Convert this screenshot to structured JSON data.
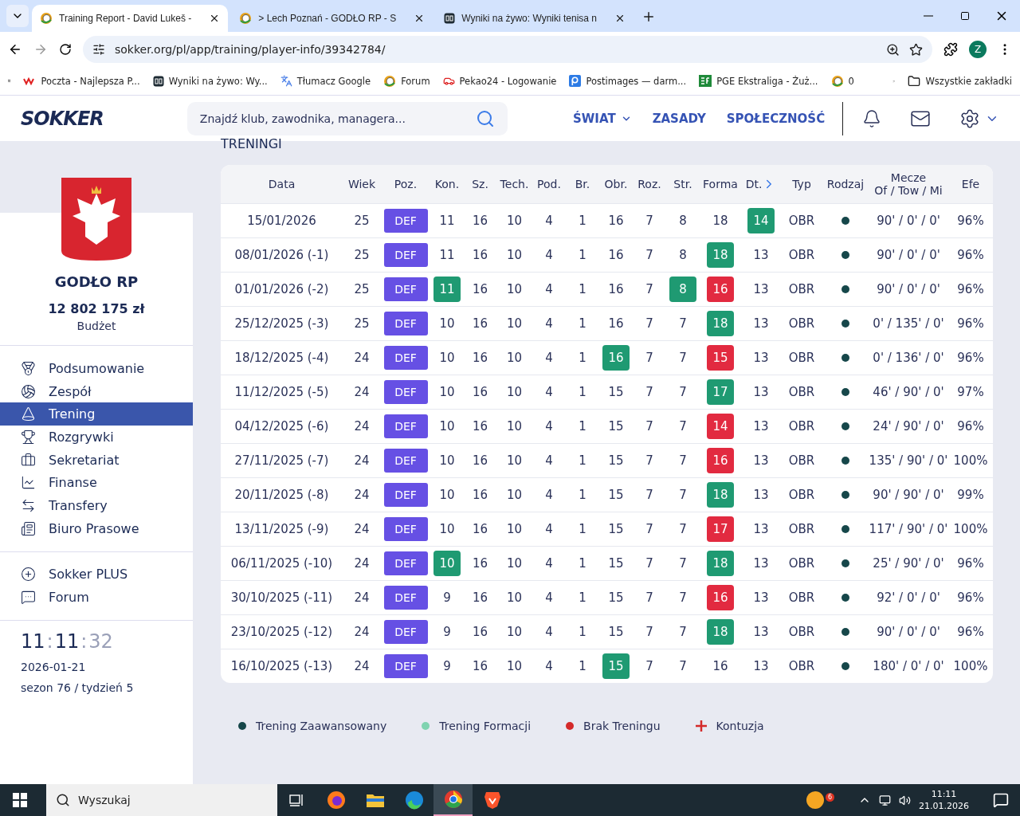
{
  "browser": {
    "tabs": [
      {
        "title": "Training Report - David Lukeš -",
        "selected": true
      },
      {
        "title": "> Lech Poznań - GODŁO RP - S",
        "selected": false
      },
      {
        "title": "Wyniki na żywo: Wyniki tenisa n",
        "selected": false
      }
    ],
    "url": "sokker.org/pl/app/training/player-info/39342784/",
    "profile": "Z",
    "bookmarks": [
      {
        "label": "Poczta - Najlepsza P..."
      },
      {
        "label": "Wyniki na żywo: Wy..."
      },
      {
        "label": "Tłumacz Google"
      },
      {
        "label": "Forum"
      },
      {
        "label": "Pekao24 - Logowanie"
      },
      {
        "label": "Postimages — darm..."
      },
      {
        "label": "PGE Ekstraliga - Żuż..."
      },
      {
        "label": "0"
      }
    ],
    "all_bookmarks": "Wszystkie zakładki"
  },
  "header": {
    "logo": "SOKKER",
    "search_placeholder": "Znajdź klub, zawodnika, managera...",
    "nav": [
      {
        "label": "ŚWIAT",
        "dropdown": true
      },
      {
        "label": "ZASADY",
        "dropdown": false
      },
      {
        "label": "SPOŁECZNOŚĆ",
        "dropdown": false
      }
    ]
  },
  "sidebar": {
    "club": "GODŁO RP",
    "budget": "12 802 175 zł",
    "budget_label": "Budżet",
    "menu": [
      {
        "label": "Podsumowanie",
        "selected": false
      },
      {
        "label": "Zespół",
        "selected": false
      },
      {
        "label": "Trening",
        "selected": true
      },
      {
        "label": "Rozgrywki",
        "selected": false
      },
      {
        "label": "Sekretariat",
        "selected": false
      },
      {
        "label": "Finanse",
        "selected": false
      },
      {
        "label": "Transfery",
        "selected": false
      },
      {
        "label": "Biuro Prasowe",
        "selected": false
      }
    ],
    "extra": [
      {
        "label": "Sokker PLUS",
        "selected": false
      },
      {
        "label": "Forum",
        "selected": false
      }
    ],
    "clock": [
      {
        "text": "11",
        "dim": false
      },
      {
        "text": ":",
        "dim": true
      },
      {
        "text": "11",
        "dim": false
      },
      {
        "text": ":",
        "dim": true
      },
      {
        "text": "32",
        "dim": true
      }
    ],
    "date": "2026-01-21",
    "season": "sezon 76 / tydzień 5"
  },
  "table": {
    "title": "TRENINGI",
    "columns": [
      {
        "label": "Data"
      },
      {
        "label": "Wiek"
      },
      {
        "label": "Poz."
      },
      {
        "label": "Kon."
      },
      {
        "label": "Sz."
      },
      {
        "label": "Tech."
      },
      {
        "label": "Pod."
      },
      {
        "label": "Br."
      },
      {
        "label": "Obr."
      },
      {
        "label": "Roz."
      },
      {
        "label": "Str."
      },
      {
        "label": "Forma"
      },
      {
        "label": "Dt.",
        "more": true
      },
      {
        "label": "Typ"
      },
      {
        "label": "Rodzaj"
      },
      {
        "label": "Mecze",
        "sub": "Of / Tow / Mi"
      },
      {
        "label": "Efe"
      }
    ],
    "rows": [
      {
        "date": "15/01/2026",
        "age": "25",
        "pos": "DEF",
        "stats": [
          {
            "v": "11",
            "up": false,
            "down": false
          },
          {
            "v": "16",
            "up": false,
            "down": false
          },
          {
            "v": "10",
            "up": false,
            "down": false
          },
          {
            "v": "4",
            "up": false,
            "down": false
          },
          {
            "v": "1",
            "up": false,
            "down": false
          },
          {
            "v": "16",
            "up": false,
            "down": false
          },
          {
            "v": "7",
            "up": false,
            "down": false
          },
          {
            "v": "8",
            "up": false,
            "down": false
          },
          {
            "v": "18",
            "up": false,
            "down": false
          },
          {
            "v": "14",
            "up": true,
            "down": false
          }
        ],
        "type": "OBR",
        "color": "#16474a",
        "matches": "90' / 0' / 0'",
        "eff": "96%"
      },
      {
        "date": "08/01/2026 (-1)",
        "age": "25",
        "pos": "DEF",
        "stats": [
          {
            "v": "11",
            "up": false,
            "down": false
          },
          {
            "v": "16",
            "up": false,
            "down": false
          },
          {
            "v": "10",
            "up": false,
            "down": false
          },
          {
            "v": "4",
            "up": false,
            "down": false
          },
          {
            "v": "1",
            "up": false,
            "down": false
          },
          {
            "v": "16",
            "up": false,
            "down": false
          },
          {
            "v": "7",
            "up": false,
            "down": false
          },
          {
            "v": "8",
            "up": false,
            "down": false
          },
          {
            "v": "18",
            "up": true,
            "down": false
          },
          {
            "v": "13",
            "up": false,
            "down": false
          }
        ],
        "type": "OBR",
        "color": "#16474a",
        "matches": "90' / 0' / 0'",
        "eff": "96%"
      },
      {
        "date": "01/01/2026 (-2)",
        "age": "25",
        "pos": "DEF",
        "stats": [
          {
            "v": "11",
            "up": true,
            "down": false
          },
          {
            "v": "16",
            "up": false,
            "down": false
          },
          {
            "v": "10",
            "up": false,
            "down": false
          },
          {
            "v": "4",
            "up": false,
            "down": false
          },
          {
            "v": "1",
            "up": false,
            "down": false
          },
          {
            "v": "16",
            "up": false,
            "down": false
          },
          {
            "v": "7",
            "up": false,
            "down": false
          },
          {
            "v": "8",
            "up": true,
            "down": false
          },
          {
            "v": "16",
            "up": false,
            "down": true
          },
          {
            "v": "13",
            "up": false,
            "down": false
          }
        ],
        "type": "OBR",
        "color": "#16474a",
        "matches": "90' / 0' / 0'",
        "eff": "96%"
      },
      {
        "date": "25/12/2025 (-3)",
        "age": "25",
        "pos": "DEF",
        "stats": [
          {
            "v": "10",
            "up": false,
            "down": false
          },
          {
            "v": "16",
            "up": false,
            "down": false
          },
          {
            "v": "10",
            "up": false,
            "down": false
          },
          {
            "v": "4",
            "up": false,
            "down": false
          },
          {
            "v": "1",
            "up": false,
            "down": false
          },
          {
            "v": "16",
            "up": false,
            "down": false
          },
          {
            "v": "7",
            "up": false,
            "down": false
          },
          {
            "v": "7",
            "up": false,
            "down": false
          },
          {
            "v": "18",
            "up": true,
            "down": false
          },
          {
            "v": "13",
            "up": false,
            "down": false
          }
        ],
        "type": "OBR",
        "color": "#16474a",
        "matches": "0' / 135' / 0'",
        "eff": "96%"
      },
      {
        "date": "18/12/2025 (-4)",
        "age": "24",
        "pos": "DEF",
        "stats": [
          {
            "v": "10",
            "up": false,
            "down": false
          },
          {
            "v": "16",
            "up": false,
            "down": false
          },
          {
            "v": "10",
            "up": false,
            "down": false
          },
          {
            "v": "4",
            "up": false,
            "down": false
          },
          {
            "v": "1",
            "up": false,
            "down": false
          },
          {
            "v": "16",
            "up": true,
            "down": false
          },
          {
            "v": "7",
            "up": false,
            "down": false
          },
          {
            "v": "7",
            "up": false,
            "down": false
          },
          {
            "v": "15",
            "up": false,
            "down": true
          },
          {
            "v": "13",
            "up": false,
            "down": false
          }
        ],
        "type": "OBR",
        "color": "#16474a",
        "matches": "0' / 136' / 0'",
        "eff": "96%"
      },
      {
        "date": "11/12/2025 (-5)",
        "age": "24",
        "pos": "DEF",
        "stats": [
          {
            "v": "10",
            "up": false,
            "down": false
          },
          {
            "v": "16",
            "up": false,
            "down": false
          },
          {
            "v": "10",
            "up": false,
            "down": false
          },
          {
            "v": "4",
            "up": false,
            "down": false
          },
          {
            "v": "1",
            "up": false,
            "down": false
          },
          {
            "v": "15",
            "up": false,
            "down": false
          },
          {
            "v": "7",
            "up": false,
            "down": false
          },
          {
            "v": "7",
            "up": false,
            "down": false
          },
          {
            "v": "17",
            "up": true,
            "down": false
          },
          {
            "v": "13",
            "up": false,
            "down": false
          }
        ],
        "type": "OBR",
        "color": "#16474a",
        "matches": "46' / 90' / 0'",
        "eff": "97%"
      },
      {
        "date": "04/12/2025 (-6)",
        "age": "24",
        "pos": "DEF",
        "stats": [
          {
            "v": "10",
            "up": false,
            "down": false
          },
          {
            "v": "16",
            "up": false,
            "down": false
          },
          {
            "v": "10",
            "up": false,
            "down": false
          },
          {
            "v": "4",
            "up": false,
            "down": false
          },
          {
            "v": "1",
            "up": false,
            "down": false
          },
          {
            "v": "15",
            "up": false,
            "down": false
          },
          {
            "v": "7",
            "up": false,
            "down": false
          },
          {
            "v": "7",
            "up": false,
            "down": false
          },
          {
            "v": "14",
            "up": false,
            "down": true
          },
          {
            "v": "13",
            "up": false,
            "down": false
          }
        ],
        "type": "OBR",
        "color": "#16474a",
        "matches": "24' / 90' / 0'",
        "eff": "96%"
      },
      {
        "date": "27/11/2025 (-7)",
        "age": "24",
        "pos": "DEF",
        "stats": [
          {
            "v": "10",
            "up": false,
            "down": false
          },
          {
            "v": "16",
            "up": false,
            "down": false
          },
          {
            "v": "10",
            "up": false,
            "down": false
          },
          {
            "v": "4",
            "up": false,
            "down": false
          },
          {
            "v": "1",
            "up": false,
            "down": false
          },
          {
            "v": "15",
            "up": false,
            "down": false
          },
          {
            "v": "7",
            "up": false,
            "down": false
          },
          {
            "v": "7",
            "up": false,
            "down": false
          },
          {
            "v": "16",
            "up": false,
            "down": true
          },
          {
            "v": "13",
            "up": false,
            "down": false
          }
        ],
        "type": "OBR",
        "color": "#16474a",
        "matches": "135' / 90' / 0'",
        "eff": "100%"
      },
      {
        "date": "20/11/2025 (-8)",
        "age": "24",
        "pos": "DEF",
        "stats": [
          {
            "v": "10",
            "up": false,
            "down": false
          },
          {
            "v": "16",
            "up": false,
            "down": false
          },
          {
            "v": "10",
            "up": false,
            "down": false
          },
          {
            "v": "4",
            "up": false,
            "down": false
          },
          {
            "v": "1",
            "up": false,
            "down": false
          },
          {
            "v": "15",
            "up": false,
            "down": false
          },
          {
            "v": "7",
            "up": false,
            "down": false
          },
          {
            "v": "7",
            "up": false,
            "down": false
          },
          {
            "v": "18",
            "up": true,
            "down": false
          },
          {
            "v": "13",
            "up": false,
            "down": false
          }
        ],
        "type": "OBR",
        "color": "#16474a",
        "matches": "90' / 90' / 0'",
        "eff": "99%"
      },
      {
        "date": "13/11/2025 (-9)",
        "age": "24",
        "pos": "DEF",
        "stats": [
          {
            "v": "10",
            "up": false,
            "down": false
          },
          {
            "v": "16",
            "up": false,
            "down": false
          },
          {
            "v": "10",
            "up": false,
            "down": false
          },
          {
            "v": "4",
            "up": false,
            "down": false
          },
          {
            "v": "1",
            "up": false,
            "down": false
          },
          {
            "v": "15",
            "up": false,
            "down": false
          },
          {
            "v": "7",
            "up": false,
            "down": false
          },
          {
            "v": "7",
            "up": false,
            "down": false
          },
          {
            "v": "17",
            "up": false,
            "down": true
          },
          {
            "v": "13",
            "up": false,
            "down": false
          }
        ],
        "type": "OBR",
        "color": "#16474a",
        "matches": "117' / 90' / 0'",
        "eff": "100%"
      },
      {
        "date": "06/11/2025 (-10)",
        "age": "24",
        "pos": "DEF",
        "stats": [
          {
            "v": "10",
            "up": true,
            "down": false
          },
          {
            "v": "16",
            "up": false,
            "down": false
          },
          {
            "v": "10",
            "up": false,
            "down": false
          },
          {
            "v": "4",
            "up": false,
            "down": false
          },
          {
            "v": "1",
            "up": false,
            "down": false
          },
          {
            "v": "15",
            "up": false,
            "down": false
          },
          {
            "v": "7",
            "up": false,
            "down": false
          },
          {
            "v": "7",
            "up": false,
            "down": false
          },
          {
            "v": "18",
            "up": true,
            "down": false
          },
          {
            "v": "13",
            "up": false,
            "down": false
          }
        ],
        "type": "OBR",
        "color": "#16474a",
        "matches": "25' / 90' / 0'",
        "eff": "96%"
      },
      {
        "date": "30/10/2025 (-11)",
        "age": "24",
        "pos": "DEF",
        "stats": [
          {
            "v": "9",
            "up": false,
            "down": false
          },
          {
            "v": "16",
            "up": false,
            "down": false
          },
          {
            "v": "10",
            "up": false,
            "down": false
          },
          {
            "v": "4",
            "up": false,
            "down": false
          },
          {
            "v": "1",
            "up": false,
            "down": false
          },
          {
            "v": "15",
            "up": false,
            "down": false
          },
          {
            "v": "7",
            "up": false,
            "down": false
          },
          {
            "v": "7",
            "up": false,
            "down": false
          },
          {
            "v": "16",
            "up": false,
            "down": true
          },
          {
            "v": "13",
            "up": false,
            "down": false
          }
        ],
        "type": "OBR",
        "color": "#16474a",
        "matches": "92' / 0' / 0'",
        "eff": "96%"
      },
      {
        "date": "23/10/2025 (-12)",
        "age": "24",
        "pos": "DEF",
        "stats": [
          {
            "v": "9",
            "up": false,
            "down": false
          },
          {
            "v": "16",
            "up": false,
            "down": false
          },
          {
            "v": "10",
            "up": false,
            "down": false
          },
          {
            "v": "4",
            "up": false,
            "down": false
          },
          {
            "v": "1",
            "up": false,
            "down": false
          },
          {
            "v": "15",
            "up": false,
            "down": false
          },
          {
            "v": "7",
            "up": false,
            "down": false
          },
          {
            "v": "7",
            "up": false,
            "down": false
          },
          {
            "v": "18",
            "up": true,
            "down": false
          },
          {
            "v": "13",
            "up": false,
            "down": false
          }
        ],
        "type": "OBR",
        "color": "#16474a",
        "matches": "90' / 0' / 0'",
        "eff": "96%"
      },
      {
        "date": "16/10/2025 (-13)",
        "age": "24",
        "pos": "DEF",
        "stats": [
          {
            "v": "9",
            "up": false,
            "down": false
          },
          {
            "v": "16",
            "up": false,
            "down": false
          },
          {
            "v": "10",
            "up": false,
            "down": false
          },
          {
            "v": "4",
            "up": false,
            "down": false
          },
          {
            "v": "1",
            "up": false,
            "down": false
          },
          {
            "v": "15",
            "up": true,
            "down": false
          },
          {
            "v": "7",
            "up": false,
            "down": false
          },
          {
            "v": "7",
            "up": false,
            "down": false
          },
          {
            "v": "16",
            "up": false,
            "down": false
          },
          {
            "v": "13",
            "up": false,
            "down": false
          }
        ],
        "type": "OBR",
        "color": "#16474a",
        "matches": "180' / 0' / 0'",
        "eff": "100%"
      }
    ]
  },
  "legend": [
    {
      "label": "Trening Zaawansowany",
      "kind": "dot",
      "color": "#16474a"
    },
    {
      "label": "Trening Formacji",
      "kind": "dot",
      "color": "#7fd3b0"
    },
    {
      "label": "Brak Treningu",
      "kind": "dot",
      "color": "#d42a2a"
    },
    {
      "label": "Kontuzja",
      "kind": "plus",
      "color": "#d42a2a"
    }
  ],
  "taskbar": {
    "search": "Wyszukaj",
    "apps": [
      {
        "selected": false
      },
      {
        "selected": false
      },
      {
        "selected": false
      },
      {
        "selected": false
      },
      {
        "selected": true
      },
      {
        "selected": false
      }
    ],
    "badge": "6",
    "time": "11:11",
    "date": "21.01.2026"
  }
}
